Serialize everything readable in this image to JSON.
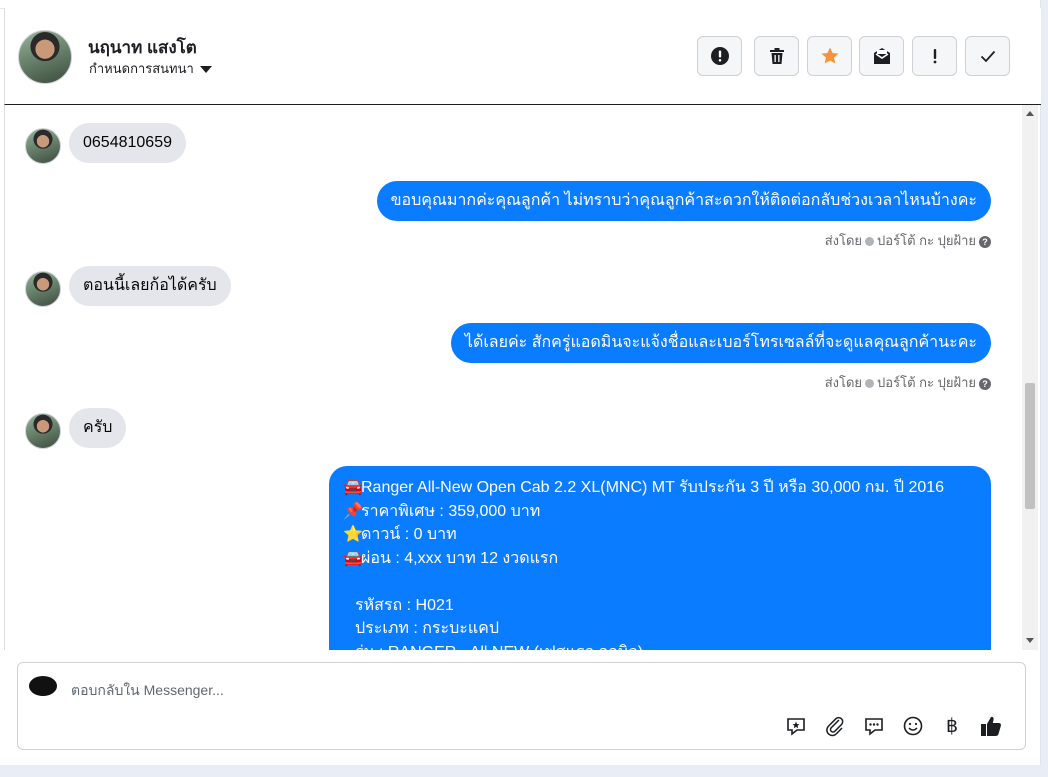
{
  "header": {
    "name": "นฤนาท แสงโต",
    "assign_label": "กำหนดการสนทนา"
  },
  "actions": [
    {
      "name": "report-spam-button",
      "icon": "exclamation-circle-icon"
    },
    {
      "name": "delete-button",
      "icon": "trash-icon"
    },
    {
      "name": "star-button",
      "icon": "star-icon"
    },
    {
      "name": "mark-unread-button",
      "icon": "envelope-icon"
    },
    {
      "name": "follow-up-button",
      "icon": "exclamation-icon"
    },
    {
      "name": "mark-done-button",
      "icon": "check-icon"
    }
  ],
  "messages": {
    "m1": "0654810659",
    "m2": "ขอบคุณมากค่ะคุณลูกค้า ไม่ทราบว่าคุณลูกค้าสะดวกให้ติดต่อกลับช่วงเวลาไหนบ้างคะ",
    "m3": "ตอนนี้เลยก้อได้ครับ",
    "m4": "ได้เลยค่ะ สักครู่แอดมินจะแจ้งชื่อและเบอร์โทรเซลล์ที่จะดูแลคุณลูกค้านะคะ",
    "m5": "ครับ",
    "sent_by": {
      "prefix": "ส่งโดย",
      "agent": "ปอร์โต้ กะ ปุยฝ้าย"
    },
    "card": {
      "line1": "Ranger All-New Open Cab 2.2 XL(MNC) MT รับประกัน 3 ปี หรือ 30,000 กม. ปี 2016",
      "line2": "ราคาพิเศษ : 359,000 บาท",
      "line3": "ดาวน์ : 0 บาท",
      "line4": "ผ่อน : 4,xxx บาท 12 งวดแรก",
      "line5": "รหัสรถ : H021",
      "line6": "ประเภท : กระบะแคป",
      "line7": "รุ่น : RANGER - All NEW (เฟสแรก ออนิว)"
    }
  },
  "composer": {
    "placeholder": "ตอบกลับใน Messenger..."
  },
  "tools": [
    {
      "name": "saved-reply-icon"
    },
    {
      "name": "attachment-icon"
    },
    {
      "name": "quick-reply-icon"
    },
    {
      "name": "emoji-icon"
    },
    {
      "name": "baht-payment-icon",
      "glyph": "฿"
    },
    {
      "name": "like-icon"
    }
  ]
}
